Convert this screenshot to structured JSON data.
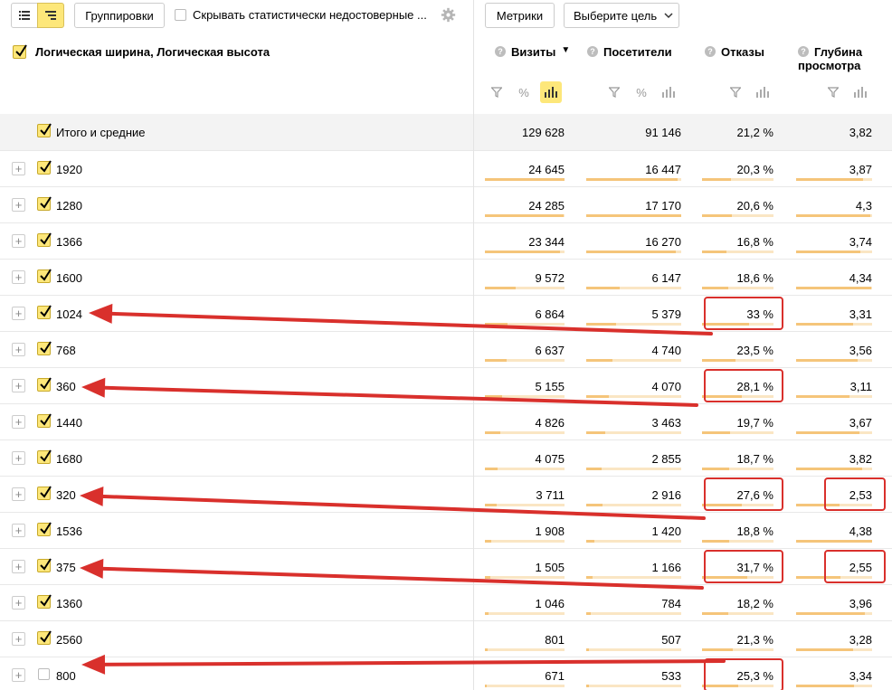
{
  "toolbar": {
    "groupings_label": "Группировки",
    "hide_label": "Скрывать статистически недостоверные ...",
    "metrics_label": "Метрики",
    "goal_label": "Выберите цель"
  },
  "header": {
    "dimension_label": "Логическая ширина, Логическая высота",
    "visits": "Визиты",
    "sort_arrow": "▼",
    "visitors": "Посетители",
    "bounces": "Отказы",
    "depth_line1": "Глубина",
    "depth_line2": "просмотра"
  },
  "total": {
    "label": "Итого и средние",
    "visits": "129 628",
    "visitors": "91 146",
    "bounces": "21,2 %",
    "depth": "3,82"
  },
  "rows": [
    {
      "label": "1920",
      "visits": "24 645",
      "visitors": "16 447",
      "bounces": "20,3 %",
      "depth": "3,87",
      "visits_share": 0.19,
      "visitors_share": 0.18,
      "bounce_rate": 0.203,
      "depth_value": 3.87,
      "checked": true
    },
    {
      "label": "1280",
      "visits": "24 285",
      "visitors": "17 170",
      "bounces": "20,6 %",
      "depth": "4,3",
      "visits_share": 0.187,
      "visitors_share": 0.188,
      "bounce_rate": 0.206,
      "depth_value": 4.3,
      "checked": true
    },
    {
      "label": "1366",
      "visits": "23 344",
      "visitors": "16 270",
      "bounces": "16,8 %",
      "depth": "3,74",
      "visits_share": 0.18,
      "visitors_share": 0.178,
      "bounce_rate": 0.168,
      "depth_value": 3.74,
      "checked": true
    },
    {
      "label": "1600",
      "visits": "9 572",
      "visitors": "6 147",
      "bounces": "18,6 %",
      "depth": "4,34",
      "visits_share": 0.074,
      "visitors_share": 0.067,
      "bounce_rate": 0.186,
      "depth_value": 4.34,
      "checked": true
    },
    {
      "label": "1024",
      "visits": "6 864",
      "visitors": "5 379",
      "bounces": "33 %",
      "depth": "3,31",
      "visits_share": 0.053,
      "visitors_share": 0.059,
      "bounce_rate": 0.33,
      "depth_value": 3.31,
      "checked": true
    },
    {
      "label": "768",
      "visits": "6 637",
      "visitors": "4 740",
      "bounces": "23,5 %",
      "depth": "3,56",
      "visits_share": 0.051,
      "visitors_share": 0.052,
      "bounce_rate": 0.235,
      "depth_value": 3.56,
      "checked": true
    },
    {
      "label": "360",
      "visits": "5 155",
      "visitors": "4 070",
      "bounces": "28,1 %",
      "depth": "3,11",
      "visits_share": 0.04,
      "visitors_share": 0.045,
      "bounce_rate": 0.281,
      "depth_value": 3.11,
      "checked": true
    },
    {
      "label": "1440",
      "visits": "4 826",
      "visitors": "3 463",
      "bounces": "19,7 %",
      "depth": "3,67",
      "visits_share": 0.037,
      "visitors_share": 0.038,
      "bounce_rate": 0.197,
      "depth_value": 3.67,
      "checked": true
    },
    {
      "label": "1680",
      "visits": "4 075",
      "visitors": "2 855",
      "bounces": "18,7 %",
      "depth": "3,82",
      "visits_share": 0.031,
      "visitors_share": 0.031,
      "bounce_rate": 0.187,
      "depth_value": 3.82,
      "checked": true
    },
    {
      "label": "320",
      "visits": "3 711",
      "visitors": "2 916",
      "bounces": "27,6 %",
      "depth": "2,53",
      "visits_share": 0.029,
      "visitors_share": 0.032,
      "bounce_rate": 0.276,
      "depth_value": 2.53,
      "checked": true
    },
    {
      "label": "1536",
      "visits": "1 908",
      "visitors": "1 420",
      "bounces": "18,8 %",
      "depth": "4,38",
      "visits_share": 0.015,
      "visitors_share": 0.016,
      "bounce_rate": 0.188,
      "depth_value": 4.38,
      "checked": true
    },
    {
      "label": "375",
      "visits": "1 505",
      "visitors": "1 166",
      "bounces": "31,7 %",
      "depth": "2,55",
      "visits_share": 0.012,
      "visitors_share": 0.013,
      "bounce_rate": 0.317,
      "depth_value": 2.55,
      "checked": true
    },
    {
      "label": "1360",
      "visits": "1 046",
      "visitors": "784",
      "bounces": "18,2 %",
      "depth": "3,96",
      "visits_share": 0.008,
      "visitors_share": 0.009,
      "bounce_rate": 0.182,
      "depth_value": 3.96,
      "checked": true
    },
    {
      "label": "2560",
      "visits": "801",
      "visitors": "507",
      "bounces": "21,3 %",
      "depth": "3,28",
      "visits_share": 0.006,
      "visitors_share": 0.006,
      "bounce_rate": 0.213,
      "depth_value": 3.28,
      "checked": true
    },
    {
      "label": "800",
      "visits": "671",
      "visitors": "533",
      "bounces": "25,3 %",
      "depth": "3,34",
      "visits_share": 0.005,
      "visitors_share": 0.006,
      "bounce_rate": 0.253,
      "depth_value": 3.34,
      "checked": false
    }
  ],
  "highlights": {
    "bounces": [
      "1024",
      "360",
      "320",
      "375",
      "800"
    ],
    "depth": [
      "320",
      "375"
    ]
  },
  "colors": {
    "accent": "#fde77a",
    "bar": "#f5c57a",
    "bar_bg": "#fae6c4",
    "annotation": "#d9302c"
  }
}
